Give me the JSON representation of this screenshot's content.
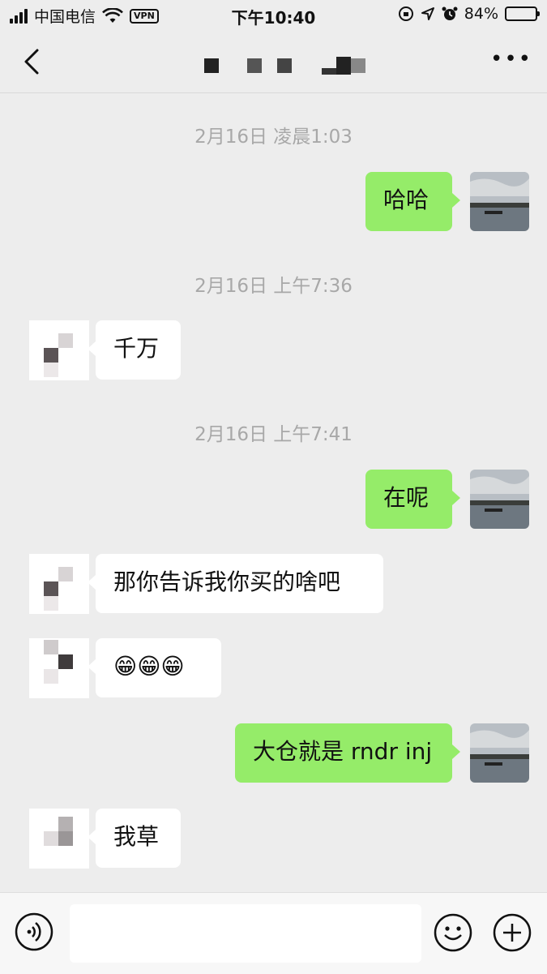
{
  "status_bar": {
    "carrier": "中国电信",
    "vpn": "VPN",
    "time": "下午10:40",
    "battery": "84%",
    "battery_level": 0.84
  },
  "header": {
    "title": ""
  },
  "messages": [
    {
      "type": "timestamp",
      "text": "2月16日 凌晨1:03"
    },
    {
      "type": "sent",
      "text": "哈哈"
    },
    {
      "type": "timestamp",
      "text": "2月16日 上午7:36"
    },
    {
      "type": "received",
      "text": "千万"
    },
    {
      "type": "timestamp",
      "text": "2月16日 上午7:41"
    },
    {
      "type": "sent",
      "text": "在呢"
    },
    {
      "type": "received",
      "text": "那你告诉我你买的啥吧"
    },
    {
      "type": "received",
      "text": "😁😁😁"
    },
    {
      "type": "sent",
      "text": "大仓就是 rndr inj"
    },
    {
      "type": "received",
      "text": "我草"
    }
  ],
  "colors": {
    "sent_bubble": "#95ec69",
    "received_bubble": "#ffffff",
    "background": "#ededed",
    "timestamp": "#a8a8a8"
  },
  "icons": {
    "back": "chevron-left-icon",
    "more": "more-icon",
    "voice": "voice-icon",
    "emoji": "emoji-icon",
    "plus": "plus-icon"
  }
}
